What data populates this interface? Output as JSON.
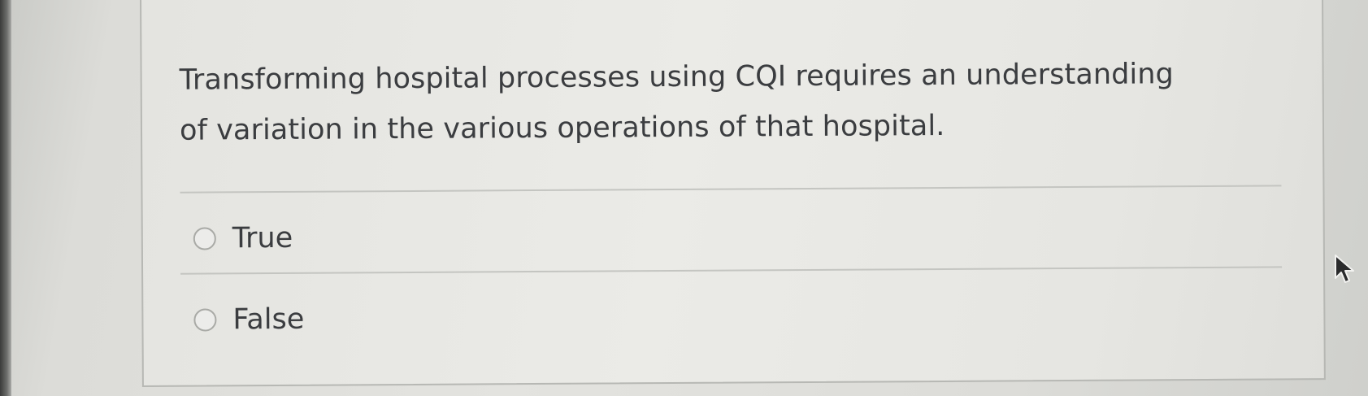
{
  "question": {
    "text": "Transforming hospital processes using CQI requires an understanding of variation in the various operations of that hospital."
  },
  "options": [
    {
      "label": "True"
    },
    {
      "label": "False"
    }
  ],
  "icons": {
    "cursor": "mouse-pointer-icon",
    "radio": "radio-unselected-icon"
  }
}
